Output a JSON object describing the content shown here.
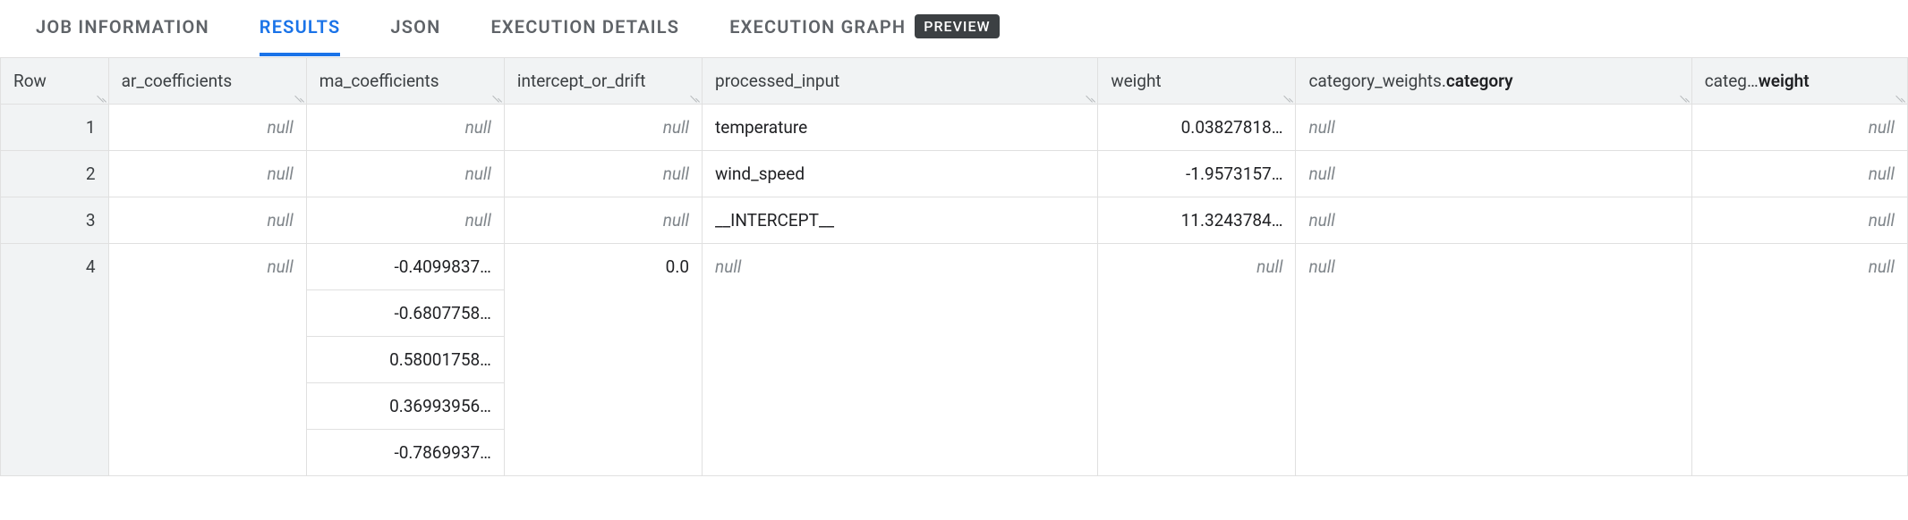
{
  "tabs": {
    "job_info": "JOB INFORMATION",
    "results": "RESULTS",
    "json": "JSON",
    "exec_details": "EXECUTION DETAILS",
    "exec_graph": "EXECUTION GRAPH",
    "preview_badge": "PREVIEW"
  },
  "columns": {
    "row": "Row",
    "ar": "ar_coefficients",
    "ma": "ma_coefficients",
    "intercept": "intercept_or_drift",
    "processed_input": "processed_input",
    "weight": "weight",
    "cat_weights_category_prefix": "category_weights.",
    "cat_weights_category_suffix": "category",
    "cat_weights_weight_prefix": "categ…",
    "cat_weights_weight_suffix": "weight"
  },
  "null_text": "null",
  "rows": [
    {
      "n": "1",
      "ar": null,
      "ma": null,
      "intercept": null,
      "processed_input": "temperature",
      "weight": "0.03827818…",
      "cwc": null,
      "cww": null
    },
    {
      "n": "2",
      "ar": null,
      "ma": null,
      "intercept": null,
      "processed_input": "wind_speed",
      "weight": "-1.9573157…",
      "cwc": null,
      "cww": null
    },
    {
      "n": "3",
      "ar": null,
      "ma": null,
      "intercept": null,
      "processed_input": "__INTERCEPT__",
      "weight": "11.3243784…",
      "cwc": null,
      "cww": null
    }
  ],
  "row4": {
    "n": "4",
    "ar": null,
    "intercept": "0.0",
    "processed_input": null,
    "weight": null,
    "cwc": null,
    "cww": null,
    "ma_values": [
      "-0.4099837…",
      "-0.6807758…",
      "0.58001758…",
      "0.36993956…",
      "-0.7869937…"
    ]
  }
}
